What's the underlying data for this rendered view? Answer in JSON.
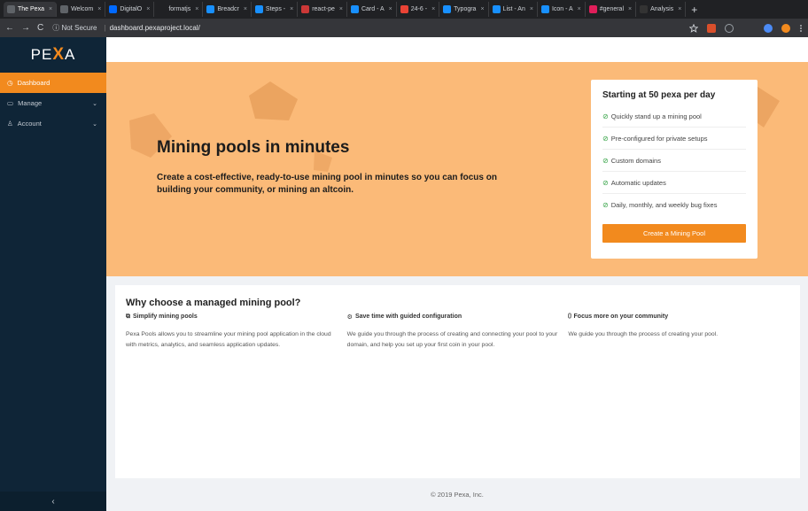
{
  "browser": {
    "tabs": [
      {
        "label": "The Pexa",
        "color": "#5f6368",
        "active": true
      },
      {
        "label": "Welcom",
        "color": "#5f6368"
      },
      {
        "label": "DigitalO",
        "color": "#0069ff"
      },
      {
        "label": "formatjs",
        "color": "#202124"
      },
      {
        "label": "Breadcr",
        "color": "#1890ff"
      },
      {
        "label": "Steps -",
        "color": "#1890ff"
      },
      {
        "label": "react-pe",
        "color": "#cb3837"
      },
      {
        "label": "Card - A",
        "color": "#1890ff"
      },
      {
        "label": "24-6 -",
        "color": "#ea4335"
      },
      {
        "label": "Typogra",
        "color": "#1890ff"
      },
      {
        "label": "List - An",
        "color": "#1890ff"
      },
      {
        "label": "Icon - A",
        "color": "#1890ff"
      },
      {
        "label": "#general",
        "color": "#e01e5a"
      },
      {
        "label": "Analysis",
        "color": "#333"
      }
    ],
    "tab_close": "×",
    "tab_new": "+",
    "nav_back": "←",
    "nav_forward": "→",
    "nav_reload": "C",
    "security": "ⓘ Not Secure",
    "separator": "|",
    "url": "dashboard.pexaproject.local/"
  },
  "sidebar": {
    "logo_left": "PE",
    "logo_mark": "X",
    "logo_right": "A",
    "items": [
      {
        "label": "Dashboard",
        "icon": "clock-icon",
        "glyph": "◷",
        "active": true
      },
      {
        "label": "Manage",
        "icon": "desktop-icon",
        "glyph": "▭",
        "chevron": "⌄"
      },
      {
        "label": "Account",
        "icon": "user-icon",
        "glyph": "♙",
        "chevron": "⌄"
      }
    ],
    "collapse": "‹"
  },
  "hero": {
    "title": "Mining pools in minutes",
    "description": "Create a cost-effective, ready-to-use mining pool in minutes so you can focus on building your community, or mining an altcoin."
  },
  "pricing": {
    "title": "Starting at 50 pexa per day",
    "check": "⊘",
    "features": [
      "Quickly stand up a mining pool",
      "Pre-configured for private setups",
      "Custom domains",
      "Automatic updates",
      "Daily, monthly, and weekly bug fixes"
    ],
    "button": "Create a Mining Pool"
  },
  "why": {
    "title": "Why choose a managed mining pool?",
    "columns": [
      {
        "glyph": "⧉",
        "icon": "copy-icon",
        "heading": "Simplify mining pools",
        "body": "Pexa Pools allows you to streamline your mining pool application in the cloud with metrics, analytics, and seamless application updates."
      },
      {
        "glyph": "⚙",
        "icon": "settings-icon",
        "heading": "Save time with guided configuration",
        "body": "We guide you through the process of creating and connecting your pool to your domain, and help you set up your first coin in your pool."
      },
      {
        "glyph": "⩇",
        "icon": "chart-icon",
        "heading": "Focus more on your community",
        "body": "We guide you through the process of creating your pool."
      }
    ]
  },
  "footer": "© 2019 Pexa, Inc.",
  "colors": {
    "accent": "#f28a1e",
    "hero_bg": "#fbba78",
    "sidebar_bg": "#0f2537",
    "decor": "#e8a05c"
  }
}
